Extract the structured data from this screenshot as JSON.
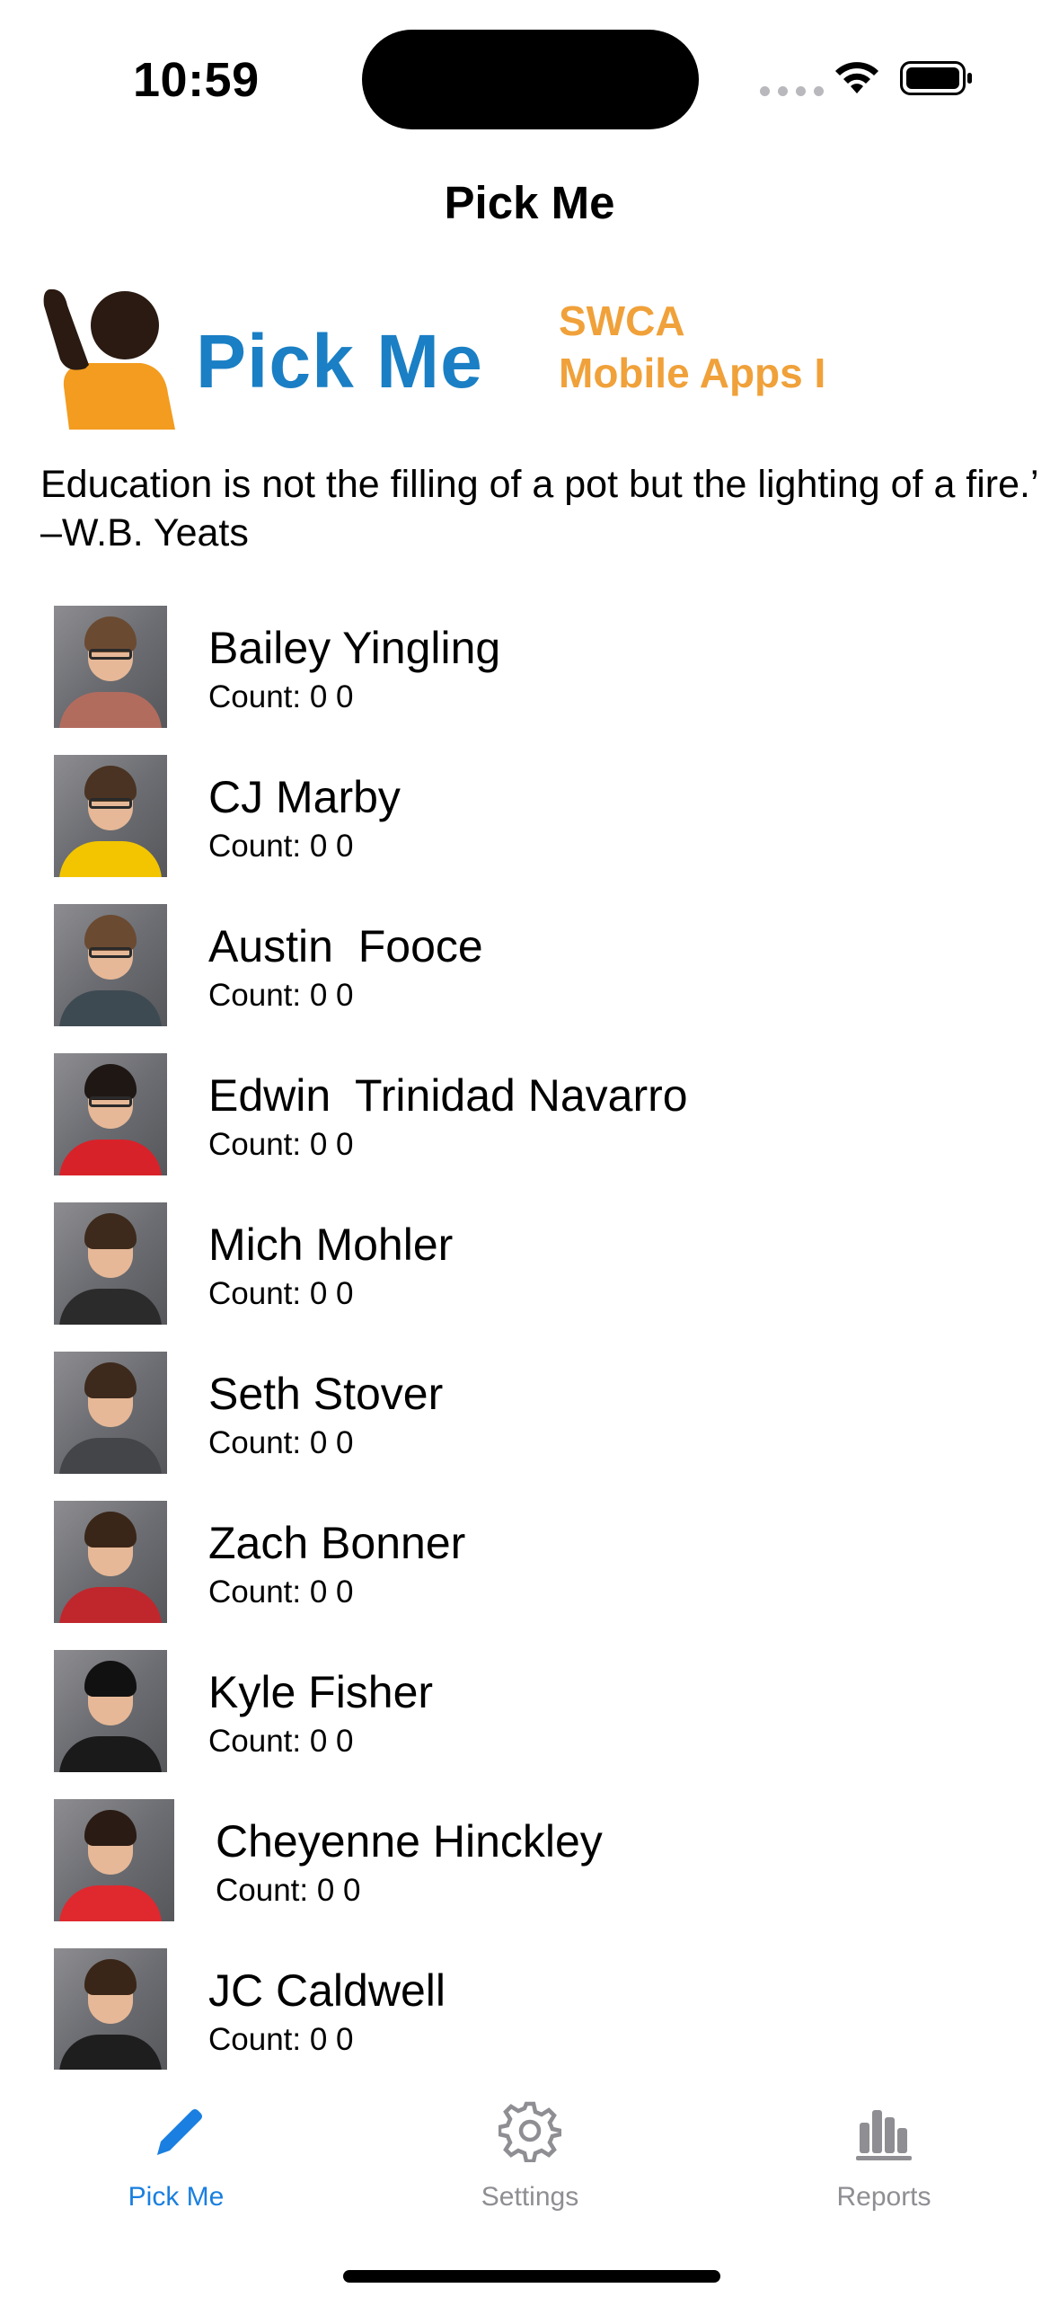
{
  "status_bar": {
    "time": "10:59",
    "icons": [
      "cellular-dots-icon",
      "wifi-icon",
      "battery-icon"
    ]
  },
  "nav": {
    "title": "Pick Me"
  },
  "header": {
    "logo_text": "Pick Me",
    "course_line1": "SWCA",
    "course_line2": "Mobile Apps I",
    "colors": {
      "logo_blue": "#1a7fc4",
      "accent_orange": "#f0a13a"
    }
  },
  "quote": "Education is not the filling of a pot but the lighting of a fire.’ –W.B. Yeats",
  "students": [
    {
      "name": "Bailey Yingling",
      "count": "Count: 0 0",
      "photo_colors": {
        "hair": "#6b4a32",
        "shirt": "#b26c5e"
      },
      "glasses": true
    },
    {
      "name": "CJ Marby",
      "count": "Count: 0 0",
      "photo_colors": {
        "hair": "#4a3322",
        "shirt": "#f2c500"
      },
      "glasses": true
    },
    {
      "name": "Austin  Fooce",
      "count": "Count: 0 0",
      "photo_colors": {
        "hair": "#6b4a32",
        "shirt": "#3e4a52"
      },
      "glasses": true
    },
    {
      "name": "Edwin  Trinidad Navarro",
      "count": "Count: 0 0",
      "photo_colors": {
        "hair": "#1e1714",
        "shirt": "#d8222a"
      },
      "glasses": true
    },
    {
      "name": "Mich Mohler",
      "count": "Count: 0 0",
      "photo_colors": {
        "hair": "#3d2a1c",
        "shirt": "#2b2b2b"
      },
      "glasses": false
    },
    {
      "name": "Seth Stover",
      "count": "Count: 0 0",
      "photo_colors": {
        "hair": "#3d2a1c",
        "shirt": "#444548"
      },
      "glasses": false
    },
    {
      "name": "Zach Bonner",
      "count": "Count: 0 0",
      "photo_colors": {
        "hair": "#3a2618",
        "shirt": "#c0272d"
      },
      "glasses": false
    },
    {
      "name": "Kyle Fisher",
      "count": "Count: 0 0",
      "photo_colors": {
        "hair": "#111111",
        "shirt": "#1a1a1a"
      },
      "glasses": false
    },
    {
      "name": "Cheyenne Hinckley",
      "count": "Count: 0 0",
      "photo_colors": {
        "hair": "#2a1c14",
        "shirt": "#e0282f"
      },
      "glasses": false
    },
    {
      "name": "JC Caldwell",
      "count": "Count: 0 0",
      "photo_colors": {
        "hair": "#3a2618",
        "shirt": "#1e1e1e"
      },
      "glasses": false
    }
  ],
  "tabs": [
    {
      "label": "Pick Me",
      "icon": "pencil-icon",
      "active": true
    },
    {
      "label": "Settings",
      "icon": "gear-icon",
      "active": false
    },
    {
      "label": "Reports",
      "icon": "bar-chart-icon",
      "active": false
    }
  ],
  "colors": {
    "tab_active": "#1a7fe0",
    "tab_inactive": "#8e8e93"
  }
}
